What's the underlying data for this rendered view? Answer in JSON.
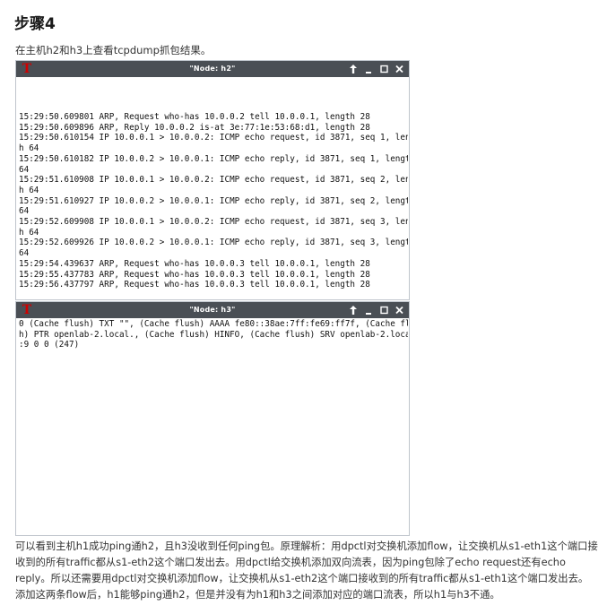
{
  "heading": "步骤4",
  "intro": "在主机h2和h3上查看tcpdump抓包结果。",
  "term_h2": {
    "title": "\"Node: h2\"",
    "lines": [
      "15:29:50.609801 ARP, Request who-has 10.0.0.2 tell 10.0.0.1, length 28",
      "15:29:50.609896 ARP, Reply 10.0.0.2 is-at 3e:77:1e:53:68:d1, length 28",
      "15:29:50.610154 IP 10.0.0.1 > 10.0.0.2: ICMP echo request, id 3871, seq 1, lengt",
      "h 64",
      "15:29:50.610182 IP 10.0.0.2 > 10.0.0.1: ICMP echo reply, id 3871, seq 1, length",
      "64",
      "15:29:51.610908 IP 10.0.0.1 > 10.0.0.2: ICMP echo request, id 3871, seq 2, lengt",
      "h 64",
      "15:29:51.610927 IP 10.0.0.2 > 10.0.0.1: ICMP echo reply, id 3871, seq 2, length",
      "64",
      "15:29:52.609908 IP 10.0.0.1 > 10.0.0.2: ICMP echo request, id 3871, seq 3, lengt",
      "h 64",
      "15:29:52.609926 IP 10.0.0.2 > 10.0.0.1: ICMP echo reply, id 3871, seq 3, length",
      "64",
      "15:29:54.439637 ARP, Request who-has 10.0.0.3 tell 10.0.0.1, length 28",
      "15:29:55.437783 ARP, Request who-has 10.0.0.3 tell 10.0.0.1, length 28",
      "15:29:56.437797 ARP, Request who-has 10.0.0.3 tell 10.0.0.1, length 28"
    ]
  },
  "term_h3": {
    "title": "\"Node: h3\"",
    "lines": [
      "0 (Cache flush) TXT \"\", (Cache flush) AAAA fe80::38ae:7ff:fe69:ff7f, (Cache flus",
      "h) PTR openlab-2.local., (Cache flush) HINFO, (Cache flush) SRV openlab-2.local.",
      ":9 0 0 (247)"
    ]
  },
  "icons": {
    "xterm_logo": "T",
    "arrow_up": "↑",
    "minimize": "_",
    "maximize": "□",
    "close": "✕"
  },
  "explanation": "可以看到主机h1成功ping通h2，且h3没收到任何ping包。原理解析：用dpctl对交换机添加flow，让交换机从s1-eth1这个端口接收到的所有traffic都从s1-eth2这个端口发出去。用dpctl给交换机添加双向流表，因为ping包除了echo request还有echo reply。所以还需要用dpctl对交换机添加flow，让交换机从s1-eth2这个端口接收到的所有traffic都从s1-eth1这个端口发出去。添加这两条flow后，h1能够ping通h2，但是并没有为h1和h3之间添加对应的端口流表，所以h1与h3不通。"
}
